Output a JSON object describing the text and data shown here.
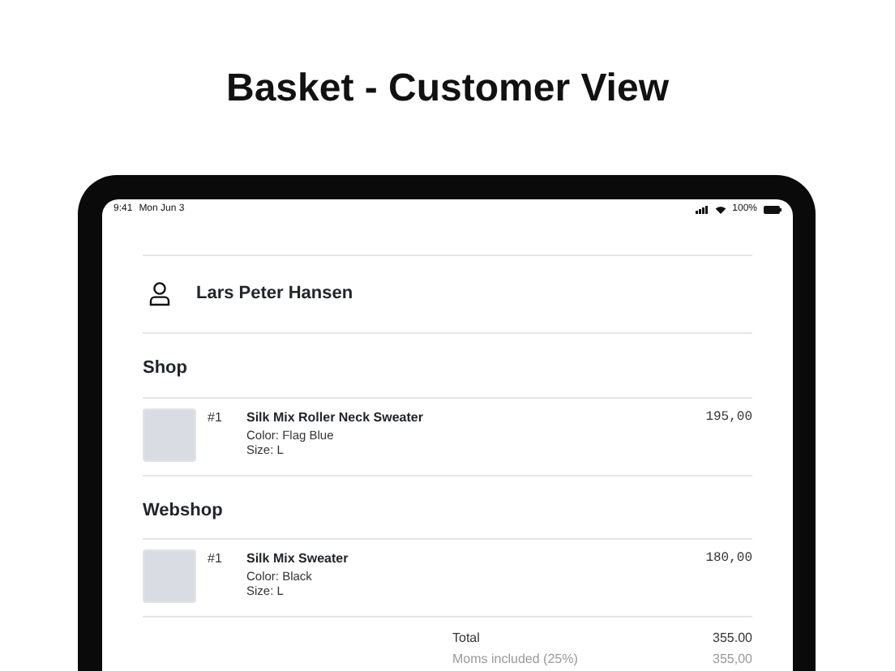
{
  "page_title": "Basket - Customer View",
  "status_bar": {
    "time": "9:41",
    "date": "Mon Jun 3",
    "battery": "100%"
  },
  "customer": {
    "name": "Lars Peter Hansen"
  },
  "sections": [
    {
      "title": "Shop",
      "items": [
        {
          "index": "#1",
          "name": "Silk Mix Roller Neck Sweater",
          "variant": "Color: Flag Blue",
          "size": "Size: L",
          "price": "195,00"
        }
      ]
    },
    {
      "title": "Webshop",
      "items": [
        {
          "index": "#1",
          "name": "Silk Mix Sweater",
          "variant": "Color: Black",
          "size": "Size: L",
          "price": "180,00"
        }
      ]
    }
  ],
  "totals": [
    {
      "label": "Total",
      "value": "355.00",
      "kind": "total"
    },
    {
      "label": "Moms included (25%)",
      "value": "355,00",
      "kind": "tax"
    }
  ]
}
